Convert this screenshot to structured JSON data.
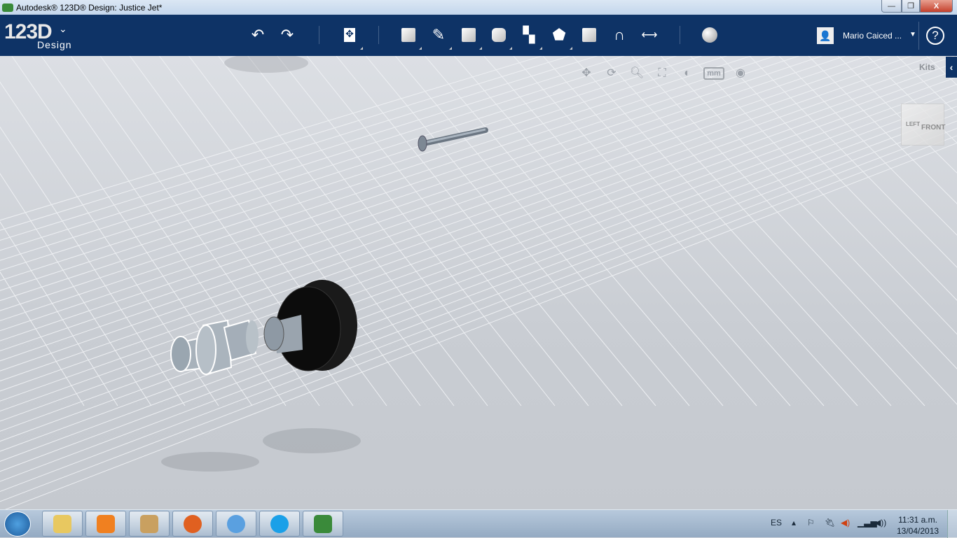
{
  "window": {
    "title": "Autodesk® 123D® Design: Justice Jet*",
    "minimize": "—",
    "maximize": "❐",
    "close": "X"
  },
  "header": {
    "logo": "123D",
    "logo_sub": "Design",
    "logo_menu": "⌄",
    "user": "Mario Caiced ...",
    "help": "?",
    "tools": [
      "undo",
      "redo",
      "transform",
      "primitives",
      "sketch",
      "construct",
      "modify",
      "pattern",
      "grouping",
      "combine",
      "snap",
      "measure",
      "materials"
    ]
  },
  "viewport": {
    "units": "mm",
    "kits": "Kits",
    "kits_toggle": "‹",
    "viewcube": {
      "left": "LEFT",
      "front": "FRONT"
    }
  },
  "taskbar": {
    "language": "ES",
    "time": "11:31 a.m.",
    "date": "13/04/2013",
    "apps": [
      "explorer",
      "media-player",
      "archive",
      "firefox",
      "messenger",
      "skype",
      "123d-design"
    ]
  }
}
